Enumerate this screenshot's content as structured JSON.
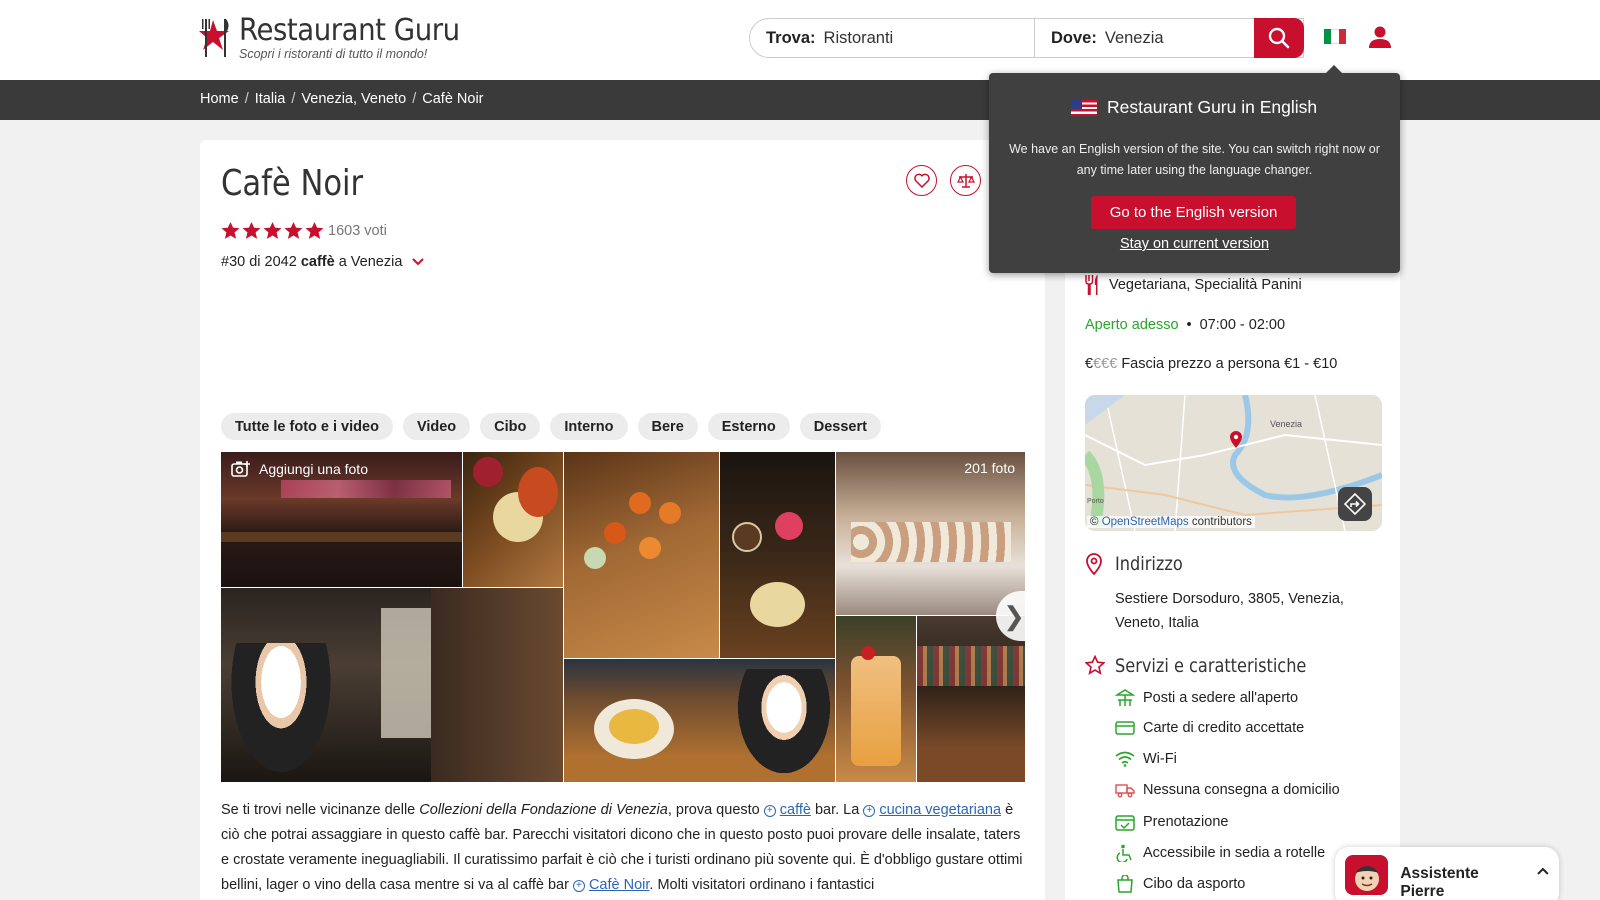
{
  "header": {
    "logo_title": "Restaurant Guru",
    "logo_subtitle": "Scopri i ristoranti di tutto il mondo!",
    "search": {
      "what_label": "Trova:",
      "what_value": "Ristoranti",
      "where_label": "Dove:",
      "where_value": "Venezia"
    },
    "icons": [
      "search-icon",
      "italian-flag-icon",
      "user-icon"
    ]
  },
  "breadcrumb": [
    "Home",
    "Italia",
    "Venezia, Veneto",
    "Cafè Noir"
  ],
  "breadcrumb_separator": "/",
  "restaurant": {
    "name": "Cafè Noir",
    "rating_stars": 5,
    "votes": "1603 voti",
    "rank_prefix": "#30 di 2042",
    "rank_bold": "caffè",
    "rank_suffix": "a Venezia"
  },
  "photo_tabs": [
    "Tutte le foto e i video",
    "Video",
    "Cibo",
    "Interno",
    "Bere",
    "Esterno",
    "Dessert"
  ],
  "photos": {
    "add_label": "Aggiungi una foto",
    "count_label": "201 foto"
  },
  "description": {
    "p1": "Se ti trovi nelle vicinanze delle ",
    "p1_em": "Collezioni della Fondazione di Venezia",
    "p2": ", prova questo ",
    "link1": "caffè",
    "p3": " bar. La ",
    "link2": "cucina vegetariana",
    "p4": " è ciò che potrai assaggiare in questo caffè bar. Parecchi visitatori dicono che in questo posto puoi provare delle insalate, taters e crostate veramente ineguagliabili. Il curatissimo parfait è ciò che i turisti ordinano più sovente qui. È d'obbligo gustare ottimi bellini, lager o vino della casa mentre si va al caffè bar ",
    "link3": "Cafè Noir",
    "p5": ". Molti visitatori ordinano i fantastici"
  },
  "sidebar": {
    "cuisine": "Vegetariana, Specialità Panini",
    "open_status": "Aperto adesso",
    "hours": "07:00 - 02:00",
    "price_symbol_active": "€",
    "price_symbol_inactive": "€€€",
    "price_text": "Fascia prezzo a persona €1 - €10",
    "map_credit_prefix": "©",
    "map_credit_link": "OpenStreetMaps",
    "map_credit_suffix": "contributors",
    "map_label": "Venezia",
    "map_label2": "Porto",
    "address_title": "Indirizzo",
    "address": "Sestiere Dorsoduro, 3805, Venezia, Veneto, Italia",
    "services_title": "Servizi e caratteristiche",
    "features": [
      "Posti a sedere all'aperto",
      "Carte di credito accettate",
      "Wi-Fi",
      "Nessuna consegna a domicilio",
      "Prenotazione",
      "Accessibile in sedia a rotelle",
      "Cibo da asporto"
    ]
  },
  "language_popup": {
    "title": "Restaurant Guru in English",
    "text": "We have an English version of the site. You can switch right now or any time later using the language changer.",
    "primary_button": "Go to the English version",
    "secondary_link": "Stay on current version"
  },
  "assistant": {
    "name": "Assistente Pierre"
  },
  "colors": {
    "brand_red": "#c8102e",
    "dark_bar": "#3a3a3a",
    "open_green": "#2aa52a",
    "link_blue": "#2a66b5"
  }
}
